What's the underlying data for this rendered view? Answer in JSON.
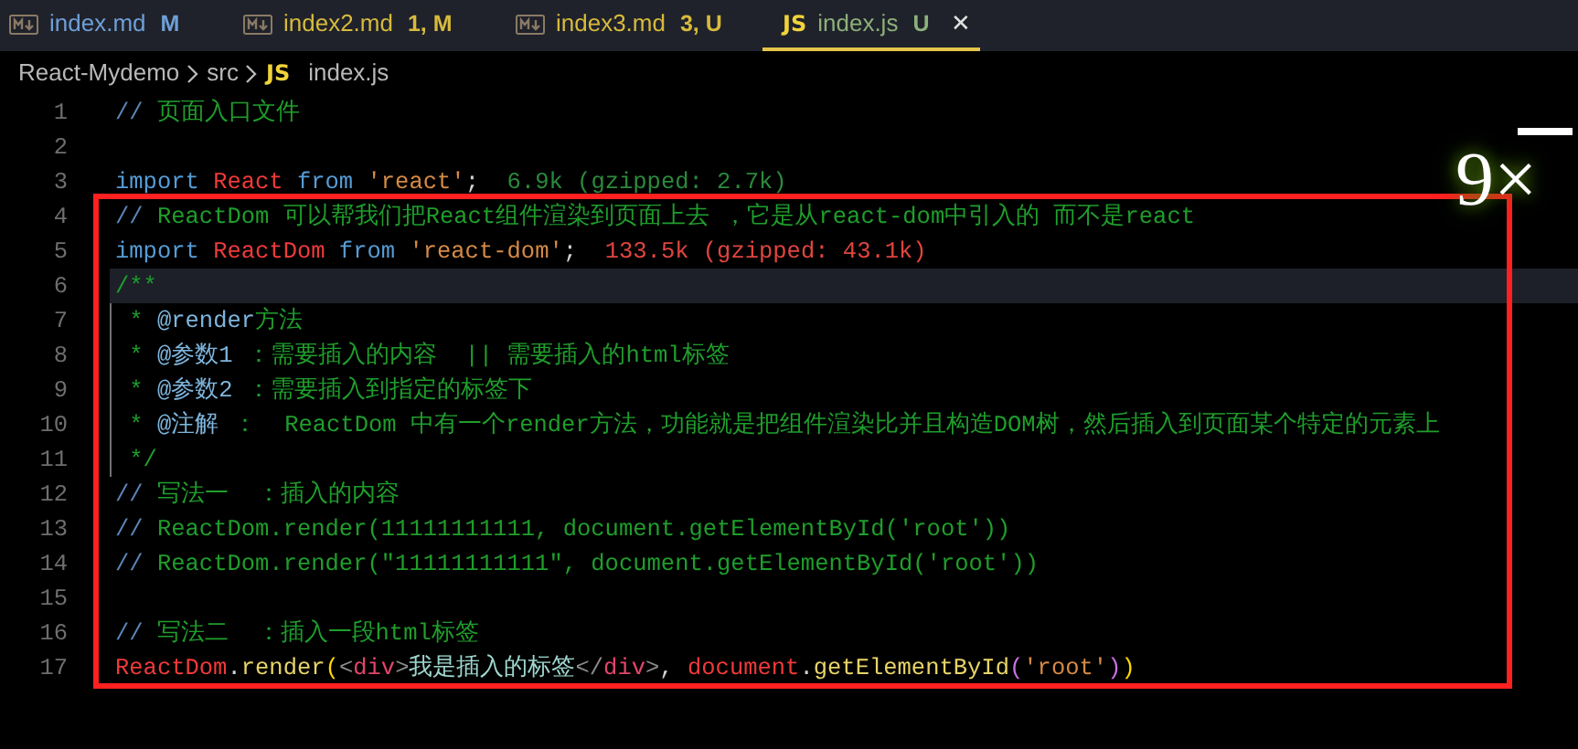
{
  "tabs": [
    {
      "label": "index.md",
      "status": "M",
      "color": "#6f9fd8",
      "selected": false,
      "kind": "markdown"
    },
    {
      "label": "index2.md",
      "status": "1, M",
      "color": "#d7ba3d",
      "selected": false,
      "kind": "markdown"
    },
    {
      "label": "index3.md",
      "status": "3, U",
      "color": "#d7ba3d",
      "selected": false,
      "kind": "markdown"
    },
    {
      "icon": "JS",
      "label": "index.js",
      "status": "U",
      "color": "#8db07a",
      "selected": true,
      "close_glyph": "✕",
      "kind": "js"
    }
  ],
  "breadcrumb": [
    {
      "label": "React-Mydemo",
      "kind": "folder"
    },
    {
      "label": "src",
      "kind": "folder"
    },
    {
      "label": "index.js",
      "icon": "JS",
      "kind": "js"
    }
  ],
  "lines": [
    {
      "number": "1",
      "current": false,
      "indent_guide": false,
      "tokens": [
        {
          "text": "// ",
          "kind": "comment-mark"
        },
        {
          "text": "页面入口文件",
          "kind": "comment"
        }
      ]
    },
    {
      "number": "2",
      "current": false,
      "indent_guide": false
    },
    {
      "number": "3",
      "current": false,
      "indent_guide": false,
      "tokens": [
        {
          "text": "import ",
          "kind": "keyword"
        },
        {
          "text": "React",
          "kind": "variable"
        },
        {
          "text": " from ",
          "kind": "keyword"
        },
        {
          "text": "'react'",
          "kind": "string"
        },
        {
          "text": ";  ",
          "kind": "punct"
        },
        {
          "text": "6.9k (gzipped: 2.7k)",
          "kind": "cost-light"
        }
      ]
    },
    {
      "number": "4",
      "current": false,
      "indent_guide": false,
      "tokens": [
        {
          "text": "// ",
          "kind": "comment-mark"
        },
        {
          "text": "ReactDom 可以帮我们把React组件渲染到页面上去 ，它是从react-dom中引入的 而不是react",
          "kind": "comment"
        }
      ]
    },
    {
      "number": "5",
      "current": false,
      "indent_guide": false,
      "tokens": [
        {
          "text": "import ",
          "kind": "keyword"
        },
        {
          "text": "ReactDom",
          "kind": "variable"
        },
        {
          "text": " from ",
          "kind": "keyword"
        },
        {
          "text": "'react-dom'",
          "kind": "string"
        },
        {
          "text": ";  ",
          "kind": "punct"
        },
        {
          "text": "133.5k (gzipped: 43.1k)",
          "kind": "cost-heavy"
        }
      ]
    },
    {
      "number": "6",
      "current": true,
      "indent_guide": false,
      "tokens": [
        {
          "text": "/**",
          "kind": "comment"
        }
      ]
    },
    {
      "number": "7",
      "current": false,
      "indent_guide": true,
      "tokens": [
        {
          "text": " * ",
          "kind": "comment"
        },
        {
          "text": "@render",
          "kind": "doc-tag"
        },
        {
          "text": "方法",
          "kind": "comment"
        }
      ]
    },
    {
      "number": "8",
      "current": false,
      "indent_guide": true,
      "tokens": [
        {
          "text": " * ",
          "kind": "comment"
        },
        {
          "text": "@参数1",
          "kind": "doc-tag"
        },
        {
          "text": " ：需要插入的内容  || 需要插入的html标签",
          "kind": "comment"
        }
      ]
    },
    {
      "number": "9",
      "current": false,
      "indent_guide": true,
      "tokens": [
        {
          "text": " * ",
          "kind": "comment"
        },
        {
          "text": "@参数2",
          "kind": "doc-tag"
        },
        {
          "text": " ：需要插入到指定的标签下",
          "kind": "comment"
        }
      ]
    },
    {
      "number": "10",
      "current": false,
      "indent_guide": true,
      "tokens": [
        {
          "text": " * ",
          "kind": "comment"
        },
        {
          "text": "@注解",
          "kind": "doc-tag"
        },
        {
          "text": " ：  ReactDom 中有一个render方法，功能就是把组件渲染比并且构造DOM树，然后插入到页面某个特定的元素上",
          "kind": "comment"
        }
      ]
    },
    {
      "number": "11",
      "current": false,
      "indent_guide": true,
      "tokens": [
        {
          "text": " */",
          "kind": "comment"
        }
      ]
    },
    {
      "number": "12",
      "current": false,
      "indent_guide": false,
      "tokens": [
        {
          "text": "// ",
          "kind": "comment-mark"
        },
        {
          "text": "写法一  ：插入的内容",
          "kind": "comment"
        }
      ]
    },
    {
      "number": "13",
      "current": false,
      "indent_guide": false,
      "tokens": [
        {
          "text": "// ",
          "kind": "comment-mark"
        },
        {
          "text": "ReactDom.render(11111111111, document.getElementById('root'))",
          "kind": "comment"
        }
      ]
    },
    {
      "number": "14",
      "current": false,
      "indent_guide": false,
      "tokens": [
        {
          "text": "// ",
          "kind": "comment-mark"
        },
        {
          "text": "ReactDom.render(\"11111111111\", document.getElementById('root'))",
          "kind": "comment"
        }
      ]
    },
    {
      "number": "15",
      "current": false,
      "indent_guide": false
    },
    {
      "number": "16",
      "current": false,
      "indent_guide": false,
      "tokens": [
        {
          "text": "// ",
          "kind": "comment-mark"
        },
        {
          "text": "写法二  ：插入一段html标签",
          "kind": "comment"
        }
      ]
    },
    {
      "number": "17",
      "current": false,
      "indent_guide": false,
      "tokens": [
        {
          "text": "ReactDom",
          "kind": "variable"
        },
        {
          "text": ".",
          "kind": "punct"
        },
        {
          "text": "render",
          "kind": "function"
        },
        {
          "text": "(",
          "kind": "paren"
        },
        {
          "text": "<",
          "kind": "tag-bracket"
        },
        {
          "text": "div",
          "kind": "tag"
        },
        {
          "text": ">",
          "kind": "tag-bracket"
        },
        {
          "text": "我是插入的标签",
          "kind": "jsx-text"
        },
        {
          "text": "</",
          "kind": "tag-bracket"
        },
        {
          "text": "div",
          "kind": "tag"
        },
        {
          "text": ">",
          "kind": "tag-bracket"
        },
        {
          "text": ", ",
          "kind": "punct"
        },
        {
          "text": "document",
          "kind": "variable"
        },
        {
          "text": ".",
          "kind": "punct"
        },
        {
          "text": "getElementById",
          "kind": "function"
        },
        {
          "text": "(",
          "kind": "paren2"
        },
        {
          "text": "'root'",
          "kind": "string"
        },
        {
          "text": ")",
          "kind": "paren2"
        },
        {
          "text": ")",
          "kind": "paren"
        }
      ]
    }
  ],
  "overlay": {
    "text": "9×"
  }
}
